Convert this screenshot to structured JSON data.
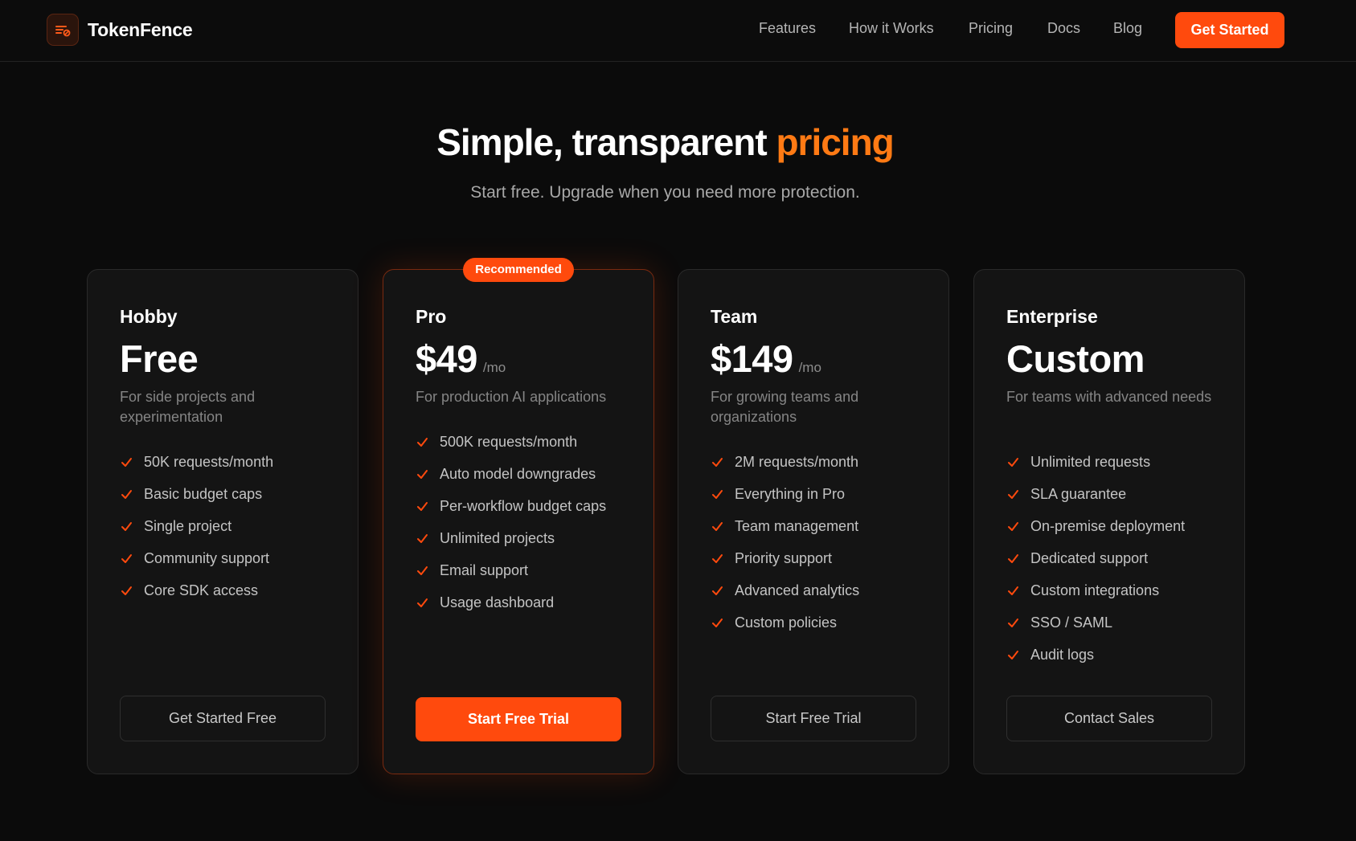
{
  "nav": {
    "brand": "TokenFence",
    "links": [
      "Features",
      "How it Works",
      "Pricing",
      "Docs",
      "Blog"
    ],
    "cta": "Get Started"
  },
  "hero": {
    "title_prefix": "Simple, transparent ",
    "title_accent": "pricing",
    "subtitle": "Start free. Upgrade when you need more protection."
  },
  "colors": {
    "accent": "#ff4a0d",
    "accent_text": "#ff7a14",
    "background": "#0b0b0b",
    "card": "#141414"
  },
  "plans": [
    {
      "name": "Hobby",
      "price": "Free",
      "per": "",
      "description": "For side projects and experimentation",
      "features": [
        "50K requests/month",
        "Basic budget caps",
        "Single project",
        "Community support",
        "Core SDK access"
      ],
      "button": "Get Started Free",
      "featured": false
    },
    {
      "name": "Pro",
      "price": "$49",
      "per": "/mo",
      "badge": "Recommended",
      "description": "For production AI applications",
      "features": [
        "500K requests/month",
        "Auto model downgrades",
        "Per-workflow budget caps",
        "Unlimited projects",
        "Email support",
        "Usage dashboard"
      ],
      "button": "Start Free Trial",
      "featured": true
    },
    {
      "name": "Team",
      "price": "$149",
      "per": "/mo",
      "description": "For growing teams and organizations",
      "features": [
        "2M requests/month",
        "Everything in Pro",
        "Team management",
        "Priority support",
        "Advanced analytics",
        "Custom policies"
      ],
      "button": "Start Free Trial",
      "featured": false
    },
    {
      "name": "Enterprise",
      "price": "Custom",
      "per": "",
      "description": "For teams with advanced needs",
      "features": [
        "Unlimited requests",
        "SLA guarantee",
        "On-premise deployment",
        "Dedicated support",
        "Custom integrations",
        "SSO / SAML",
        "Audit logs"
      ],
      "button": "Contact Sales",
      "featured": false
    }
  ]
}
